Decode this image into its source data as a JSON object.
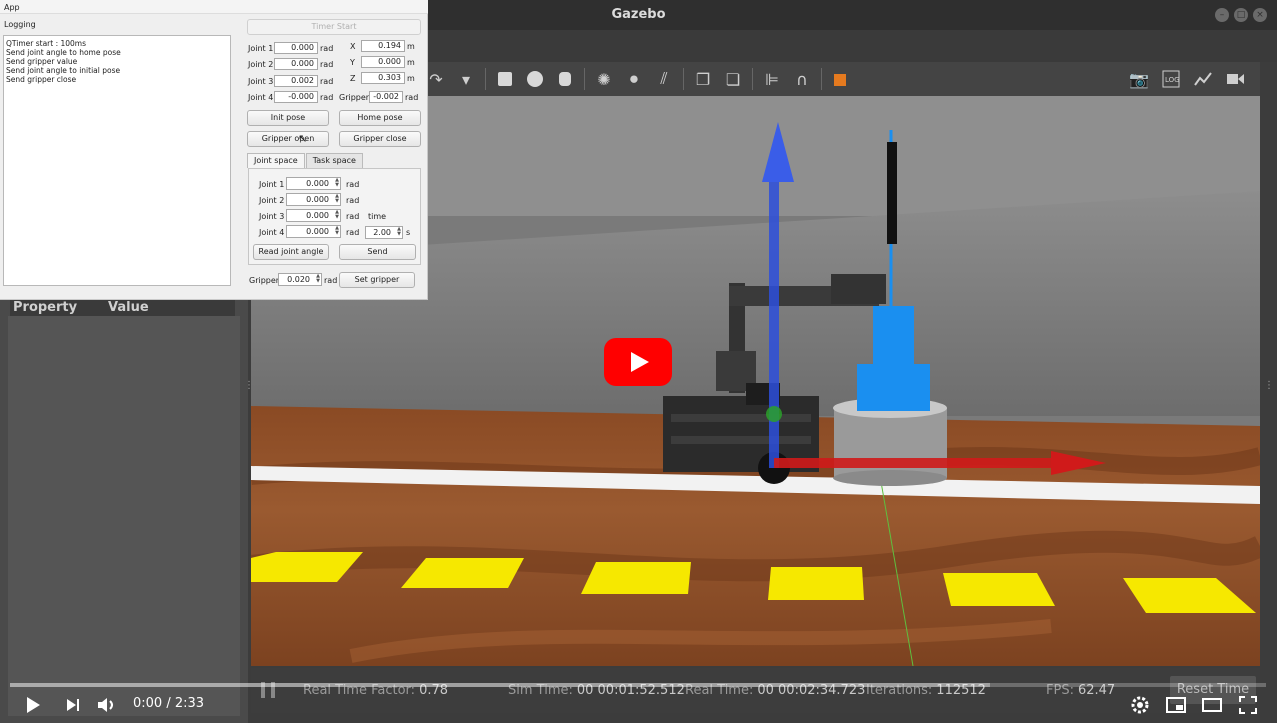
{
  "gazebo": {
    "title": "Gazebo",
    "window_buttons": [
      "–",
      "□",
      "×"
    ]
  },
  "left_panel": {
    "property_header": "Property",
    "value_header": "Value"
  },
  "status_bar": {
    "real_time_factor_label": "Real Time Factor:",
    "real_time_factor": "0.78",
    "sim_time_label": "Sim Time:",
    "sim_time": "00 00:01:52.512",
    "real_time_label": "Real Time:",
    "real_time": "00 00:02:34.723",
    "iterations_label": "Iterations:",
    "iterations": "112512",
    "fps_label": "FPS:",
    "fps": "62.47",
    "reset_label": "Reset Time"
  },
  "app": {
    "menu": "App",
    "logging_label": "Logging",
    "log_lines": [
      "QTimer start : 100ms",
      "Send joint angle to home pose",
      "Send gripper value",
      "Send joint angle to initial pose",
      "Send gripper close"
    ],
    "timer_start": "Timer Start",
    "joints": [
      {
        "label": "Joint 1",
        "value": "0.000",
        "unit": "rad"
      },
      {
        "label": "Joint 2",
        "value": "0.000",
        "unit": "rad"
      },
      {
        "label": "Joint 3",
        "value": "0.002",
        "unit": "rad"
      },
      {
        "label": "Joint 4",
        "value": "-0.000",
        "unit": "rad"
      }
    ],
    "coords": [
      {
        "label": "X",
        "value": "0.194",
        "unit": "m"
      },
      {
        "label": "Y",
        "value": "0.000",
        "unit": "m"
      },
      {
        "label": "Z",
        "value": "0.303",
        "unit": "m"
      }
    ],
    "gripper_label": "Gripper",
    "gripper_value": "-0.002",
    "gripper_unit": "rad",
    "init_pose": "Init pose",
    "home_pose": "Home pose",
    "gripper_open": "Gripper open",
    "gripper_close": "Gripper close",
    "tabs": [
      "Joint space",
      "Task space"
    ],
    "joint_space": [
      {
        "label": "Joint 1",
        "value": "0.000",
        "unit": "rad"
      },
      {
        "label": "Joint 2",
        "value": "0.000",
        "unit": "rad"
      },
      {
        "label": "Joint 3",
        "value": "0.000",
        "unit": "rad"
      },
      {
        "label": "Joint 4",
        "value": "0.000",
        "unit": "rad"
      }
    ],
    "time_label": "time",
    "time_value": "2.00",
    "time_unit": "s",
    "read_joint_angle": "Read joint angle",
    "send": "Send",
    "set_gripper_label": "Gripper",
    "set_gripper_value": "0.020",
    "set_gripper_unit": "rad",
    "set_gripper": "Set gripper"
  },
  "player": {
    "time": "0:00 / 2:33",
    "progress_fraction": 0.0,
    "icons": [
      "play-icon",
      "next-icon",
      "volume-icon",
      "settings-icon",
      "miniplayer-icon",
      "theater-icon",
      "fullscreen-icon"
    ]
  }
}
